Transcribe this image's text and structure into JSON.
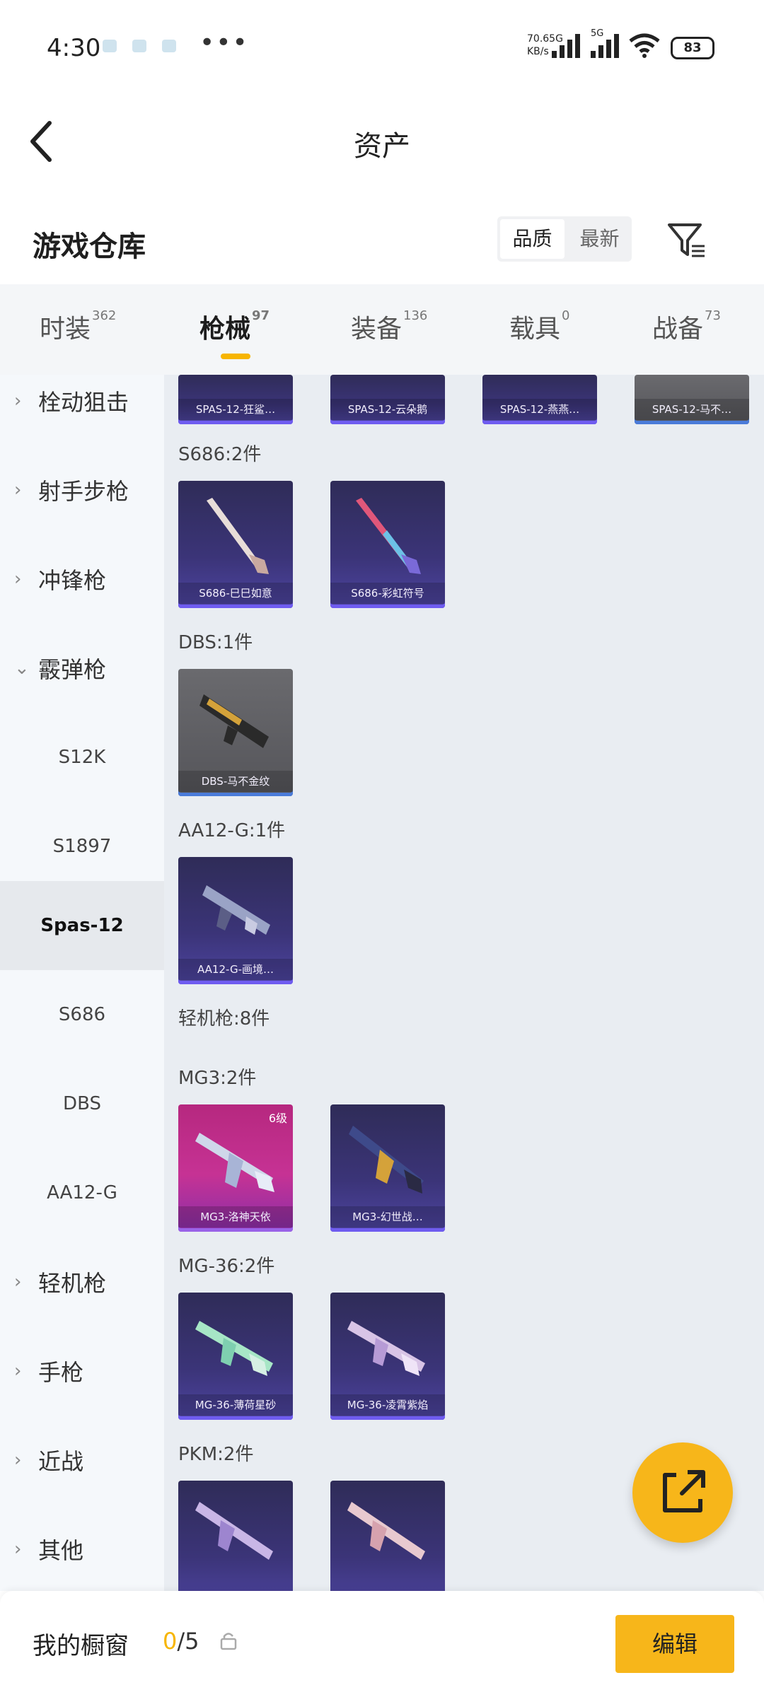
{
  "status_bar": {
    "time": "4:30",
    "net_speed": "70.6",
    "net_unit": "KB/s",
    "net_type_1": "5G",
    "net_type_2": "5G",
    "battery": "83"
  },
  "header": {
    "title": "资产"
  },
  "warehouse": {
    "title": "游戏仓库",
    "sort_options": [
      "品质",
      "最新"
    ],
    "sort_selected": "品质"
  },
  "tabs": [
    {
      "label": "时装",
      "count": "362"
    },
    {
      "label": "枪械",
      "count": "97",
      "active": true
    },
    {
      "label": "装备",
      "count": "136"
    },
    {
      "label": "载具",
      "count": "0"
    },
    {
      "label": "战备",
      "count": "73"
    }
  ],
  "sidebar": {
    "items": [
      {
        "label": "栓动狙击",
        "type": "group",
        "expanded": false
      },
      {
        "label": "射手步枪",
        "type": "group",
        "expanded": false
      },
      {
        "label": "冲锋枪",
        "type": "group",
        "expanded": false
      },
      {
        "label": "霰弹枪",
        "type": "group",
        "expanded": true
      },
      {
        "label": "S12K",
        "type": "sub"
      },
      {
        "label": "S1897",
        "type": "sub"
      },
      {
        "label": "Spas-12",
        "type": "sub",
        "active": true
      },
      {
        "label": "S686",
        "type": "sub"
      },
      {
        "label": "DBS",
        "type": "sub"
      },
      {
        "label": "AA12-G",
        "type": "sub"
      },
      {
        "label": "轻机枪",
        "type": "group",
        "expanded": false
      },
      {
        "label": "手枪",
        "type": "group",
        "expanded": false
      },
      {
        "label": "近战",
        "type": "group",
        "expanded": false
      },
      {
        "label": "其他",
        "type": "group",
        "expanded": false
      }
    ]
  },
  "content": {
    "top_row": [
      {
        "name": "SPAS-12-狂鲨…",
        "rarity": "purple"
      },
      {
        "name": "SPAS-12-云朵鹅",
        "rarity": "purple"
      },
      {
        "name": "SPAS-12-燕燕…",
        "rarity": "purple"
      },
      {
        "name": "SPAS-12-马不…",
        "rarity": "gray"
      }
    ],
    "sections": [
      {
        "heading": "S686:2件",
        "items": [
          {
            "name": "S686-巳巳如意",
            "rarity": "purple"
          },
          {
            "name": "S686-彩虹符号",
            "rarity": "purple"
          }
        ]
      },
      {
        "heading": "DBS:1件",
        "items": [
          {
            "name": "DBS-马不金纹",
            "rarity": "gray"
          }
        ]
      },
      {
        "heading": "AA12-G:1件",
        "items": [
          {
            "name": "AA12-G-画境…",
            "rarity": "purple"
          }
        ]
      },
      {
        "heading": "轻机枪:8件",
        "items": []
      },
      {
        "heading": "MG3:2件",
        "items": [
          {
            "name": "MG3-洛神天依",
            "rarity": "pink",
            "level": "6级"
          },
          {
            "name": "MG3-幻世战…",
            "rarity": "purple"
          }
        ]
      },
      {
        "heading": "MG-36:2件",
        "items": [
          {
            "name": "MG-36-薄荷星砂",
            "rarity": "purple"
          },
          {
            "name": "MG-36-凌霄紫焰",
            "rarity": "purple"
          }
        ]
      },
      {
        "heading": "PKM:2件",
        "items": [
          {
            "name": "",
            "rarity": "purple"
          },
          {
            "name": "",
            "rarity": "purple"
          }
        ]
      }
    ]
  },
  "bottom_bar": {
    "label": "我的橱窗",
    "count_current": "0",
    "count_total": "/5",
    "edit_label": "编辑"
  },
  "colors": {
    "accent": "#f7b61a",
    "sidebar_bg": "#f5f8fb",
    "content_bg": "#e9edf2",
    "card_purple": "#3b3478",
    "card_gray": "#5e5e63",
    "card_pink": "#c63294"
  },
  "icons": {
    "back": "chevron-left-icon",
    "filter": "filter-icon",
    "fab": "share-external-icon",
    "lock": "lock-icon"
  }
}
